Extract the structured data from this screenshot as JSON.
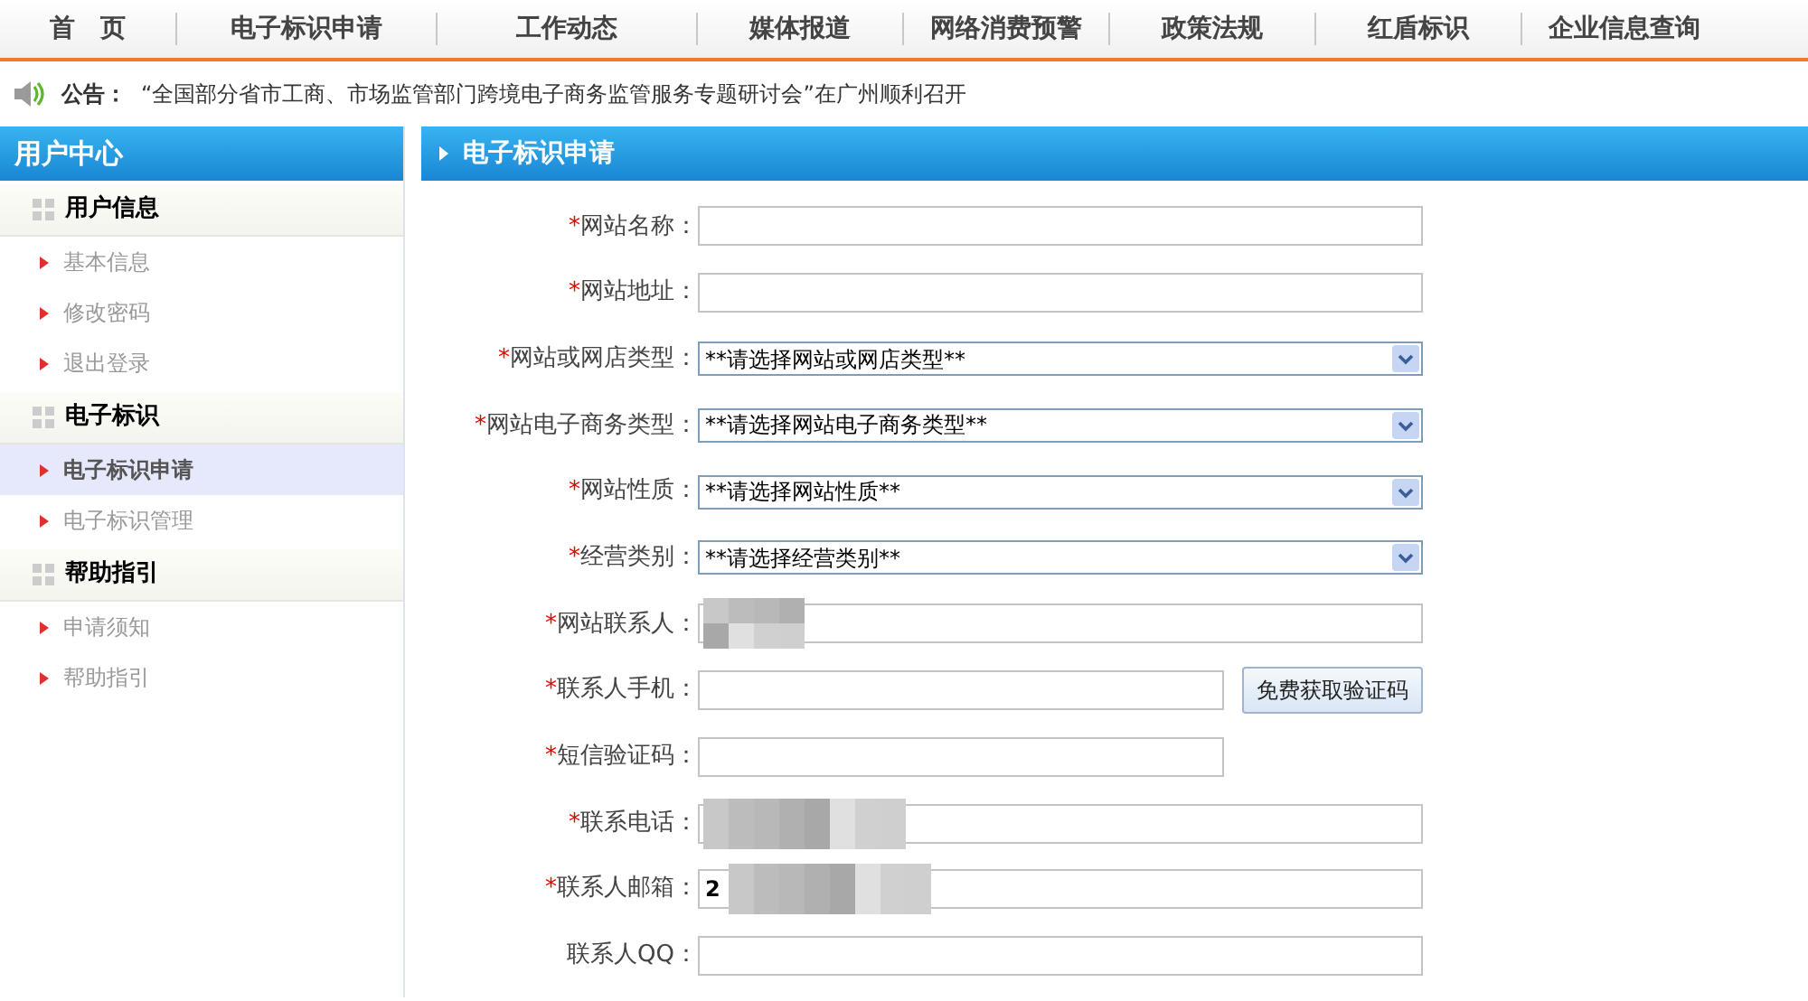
{
  "nav": [
    {
      "label": "首　页",
      "selected": false
    },
    {
      "label": "电子标识申请",
      "selected": false
    },
    {
      "label": "工作动态",
      "selected": false
    },
    {
      "label": "媒体报道",
      "selected": false
    },
    {
      "label": "网络消费预警",
      "selected": false
    },
    {
      "label": "政策法规",
      "selected": false
    },
    {
      "label": "红盾标识",
      "selected": false
    },
    {
      "label": "企业信息查询",
      "selected": false
    }
  ],
  "announcement": {
    "label": "公告：",
    "text": "“全国部分省市工商、市场监管部门跨境电子商务监管服务专题研讨会”在广州顺利召开"
  },
  "sidebar": {
    "title": "用户中心",
    "groups": [
      {
        "title": "用户信息",
        "items": [
          {
            "label": "基本信息",
            "selected": false
          },
          {
            "label": "修改密码",
            "selected": false
          },
          {
            "label": "退出登录",
            "selected": false
          }
        ]
      },
      {
        "title": "电子标识",
        "items": [
          {
            "label": "电子标识申请",
            "selected": true
          },
          {
            "label": "电子标识管理",
            "selected": false
          }
        ]
      },
      {
        "title": "帮助指引",
        "items": [
          {
            "label": "申请须知",
            "selected": false
          },
          {
            "label": "帮助指引",
            "selected": false
          }
        ]
      }
    ]
  },
  "main": {
    "title": "电子标识申请",
    "fields": [
      {
        "kind": "text",
        "label": "网站名称：",
        "required_mark": "*"
      },
      {
        "kind": "text",
        "label": "网站地址：",
        "required_mark": "*"
      },
      {
        "kind": "select",
        "label": "网站或网店类型：",
        "required_mark": "*",
        "value": "**请选择网站或网店类型**"
      },
      {
        "kind": "select",
        "label": "网站电子商务类型：",
        "required_mark": "*",
        "value": "**请选择网站电子商务类型**"
      },
      {
        "kind": "select",
        "label": "网站性质：",
        "required_mark": "*",
        "value": "**请选择网站性质**"
      },
      {
        "kind": "select",
        "label": "经营类别：",
        "required_mark": "*",
        "value": "**请选择经营类别**"
      },
      {
        "kind": "redacted",
        "label": "网站联系人：",
        "required_mark": "*"
      },
      {
        "kind": "text_button",
        "label": "联系人手机：",
        "required_mark": "*",
        "button": "免费获取验证码"
      },
      {
        "kind": "short",
        "label": "短信验证码：",
        "required_mark": "*"
      },
      {
        "kind": "redacted",
        "label": "联系电话：",
        "required_mark": "*"
      },
      {
        "kind": "redacted",
        "label": "联系人邮箱：",
        "required_mark": "*",
        "value": "2"
      },
      {
        "kind": "text",
        "label": "联系人QQ："
      }
    ]
  }
}
